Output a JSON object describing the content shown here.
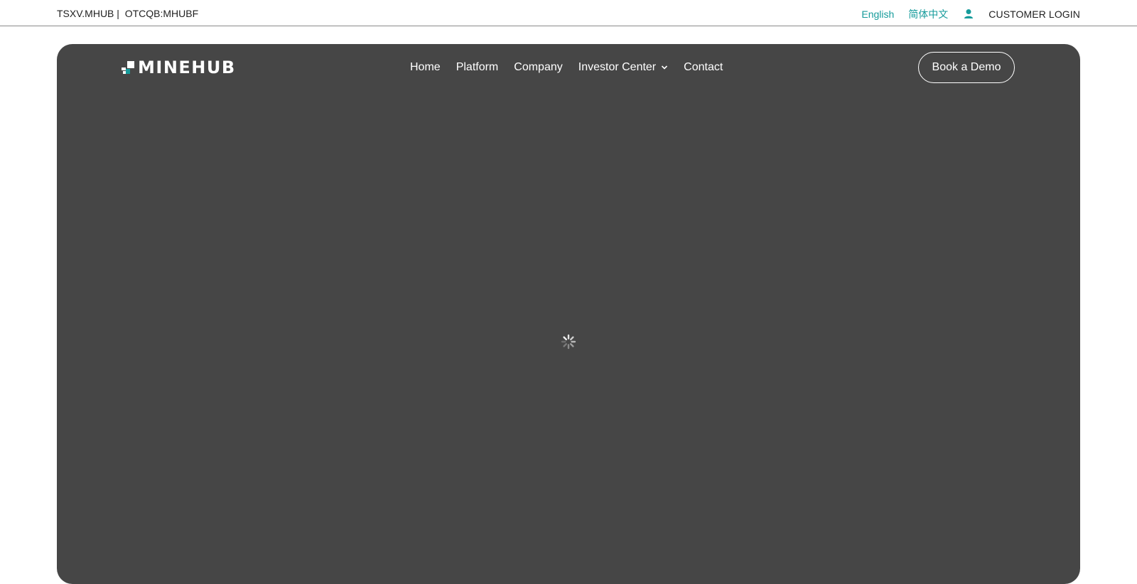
{
  "topbar": {
    "ticker": "TSXV.MHUB |  OTCQB:MHUBF",
    "lang_english": "English",
    "lang_chinese": "简体中文",
    "customer_login": "CUSTOMER LOGIN",
    "accent_color": "#169b9b"
  },
  "header": {
    "logo_text": "MINEHUB",
    "nav": {
      "home": "Home",
      "platform": "Platform",
      "company": "Company",
      "investor_center": "Investor Center",
      "contact": "Contact"
    },
    "cta": "Book a Demo"
  },
  "hero": {
    "background_color": "#464646",
    "state": "loading",
    "spinner_icon": "loading-spinner-icon"
  }
}
